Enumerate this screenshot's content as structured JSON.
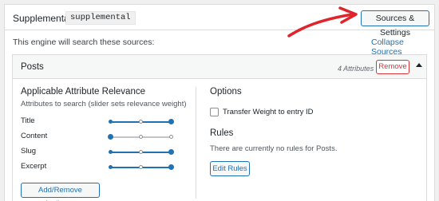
{
  "engine": {
    "label": "Supplemental",
    "slug": "supplemental",
    "sources_button": "Sources & Settings",
    "intro": "This engine will search these sources:",
    "collapse_link": "Collapse Sources"
  },
  "source": {
    "title": "Posts",
    "attribute_count": "4 Attributes",
    "remove_button": "Remove",
    "toggle_icon": "triangle-up"
  },
  "relevance": {
    "title": "Applicable Attribute Relevance",
    "subtitle": "Attributes to search (slider sets relevance weight)",
    "attributes": [
      {
        "name": "Title",
        "level": 1.0
      },
      {
        "name": "Content",
        "level": 0.0
      },
      {
        "name": "Slug",
        "level": 1.0
      },
      {
        "name": "Excerpt",
        "level": 1.0
      }
    ],
    "add_button": "Add/Remove Attributes"
  },
  "options": {
    "title": "Options",
    "transfer_weight": {
      "label": "Transfer Weight to entry ID",
      "checked": false
    }
  },
  "rules": {
    "title": "Rules",
    "empty_text": "There are currently no rules for Posts.",
    "edit_button": "Edit Rules"
  },
  "colors": {
    "accent": "#2271b1",
    "danger": "#d63638",
    "annotation_arrow": "#e0242b"
  }
}
